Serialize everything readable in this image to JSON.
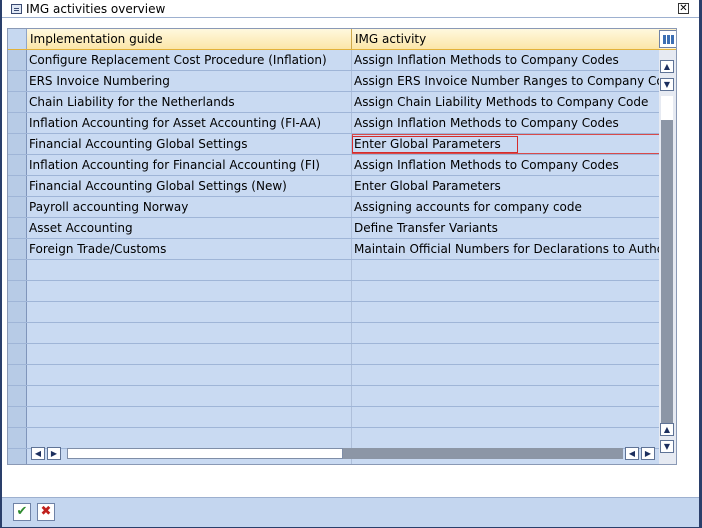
{
  "window": {
    "title": "IMG activities overview",
    "close_glyph": "✕"
  },
  "table": {
    "headers": {
      "implementation_guide": "Implementation guide",
      "img_activity": "IMG activity"
    },
    "rows": [
      {
        "guide": "Configure Replacement Cost Procedure (Inflation)",
        "activity": "Assign Inflation Methods to Company Codes"
      },
      {
        "guide": "ERS Invoice Numbering",
        "activity": "Assign ERS Invoice Number Ranges to Company Codes"
      },
      {
        "guide": "Chain Liability for the Netherlands",
        "activity": "Assign Chain Liability Methods to Company Code"
      },
      {
        "guide": "Inflation Accounting for Asset Accounting (FI-AA)",
        "activity": "Assign Inflation Methods to Company Codes"
      },
      {
        "guide": "Financial Accounting Global Settings",
        "activity": "Enter Global Parameters"
      },
      {
        "guide": "Inflation Accounting for Financial Accounting (FI)",
        "activity": "Assign Inflation Methods to Company Codes"
      },
      {
        "guide": "Financial Accounting Global Settings (New)",
        "activity": "Enter Global Parameters"
      },
      {
        "guide": "Payroll accounting Norway",
        "activity": "Assigning accounts for company code"
      },
      {
        "guide": "Asset Accounting",
        "activity": "Define Transfer Variants"
      },
      {
        "guide": "Foreign Trade/Customs",
        "activity": "Maintain Official Numbers for Declarations to Authorities"
      },
      {
        "guide": "",
        "activity": ""
      },
      {
        "guide": "",
        "activity": ""
      },
      {
        "guide": "",
        "activity": ""
      },
      {
        "guide": "",
        "activity": ""
      },
      {
        "guide": "",
        "activity": ""
      },
      {
        "guide": "",
        "activity": ""
      },
      {
        "guide": "",
        "activity": ""
      },
      {
        "guide": "",
        "activity": ""
      },
      {
        "guide": "",
        "activity": ""
      },
      {
        "guide": "",
        "activity": ""
      }
    ],
    "highlighted_row_index": 4
  },
  "icons": {
    "scroll_up": "▲",
    "scroll_down": "▼",
    "scroll_left": "◀",
    "scroll_right": "▶"
  },
  "footer": {
    "confirm_glyph": "✔",
    "cancel_glyph": "✖"
  },
  "colors": {
    "header_bg": "#fbe6a8",
    "row_bg": "#c9daf2",
    "highlight_border": "#d42c2c",
    "confirm": "#2e8b2e",
    "cancel": "#c0201c"
  }
}
